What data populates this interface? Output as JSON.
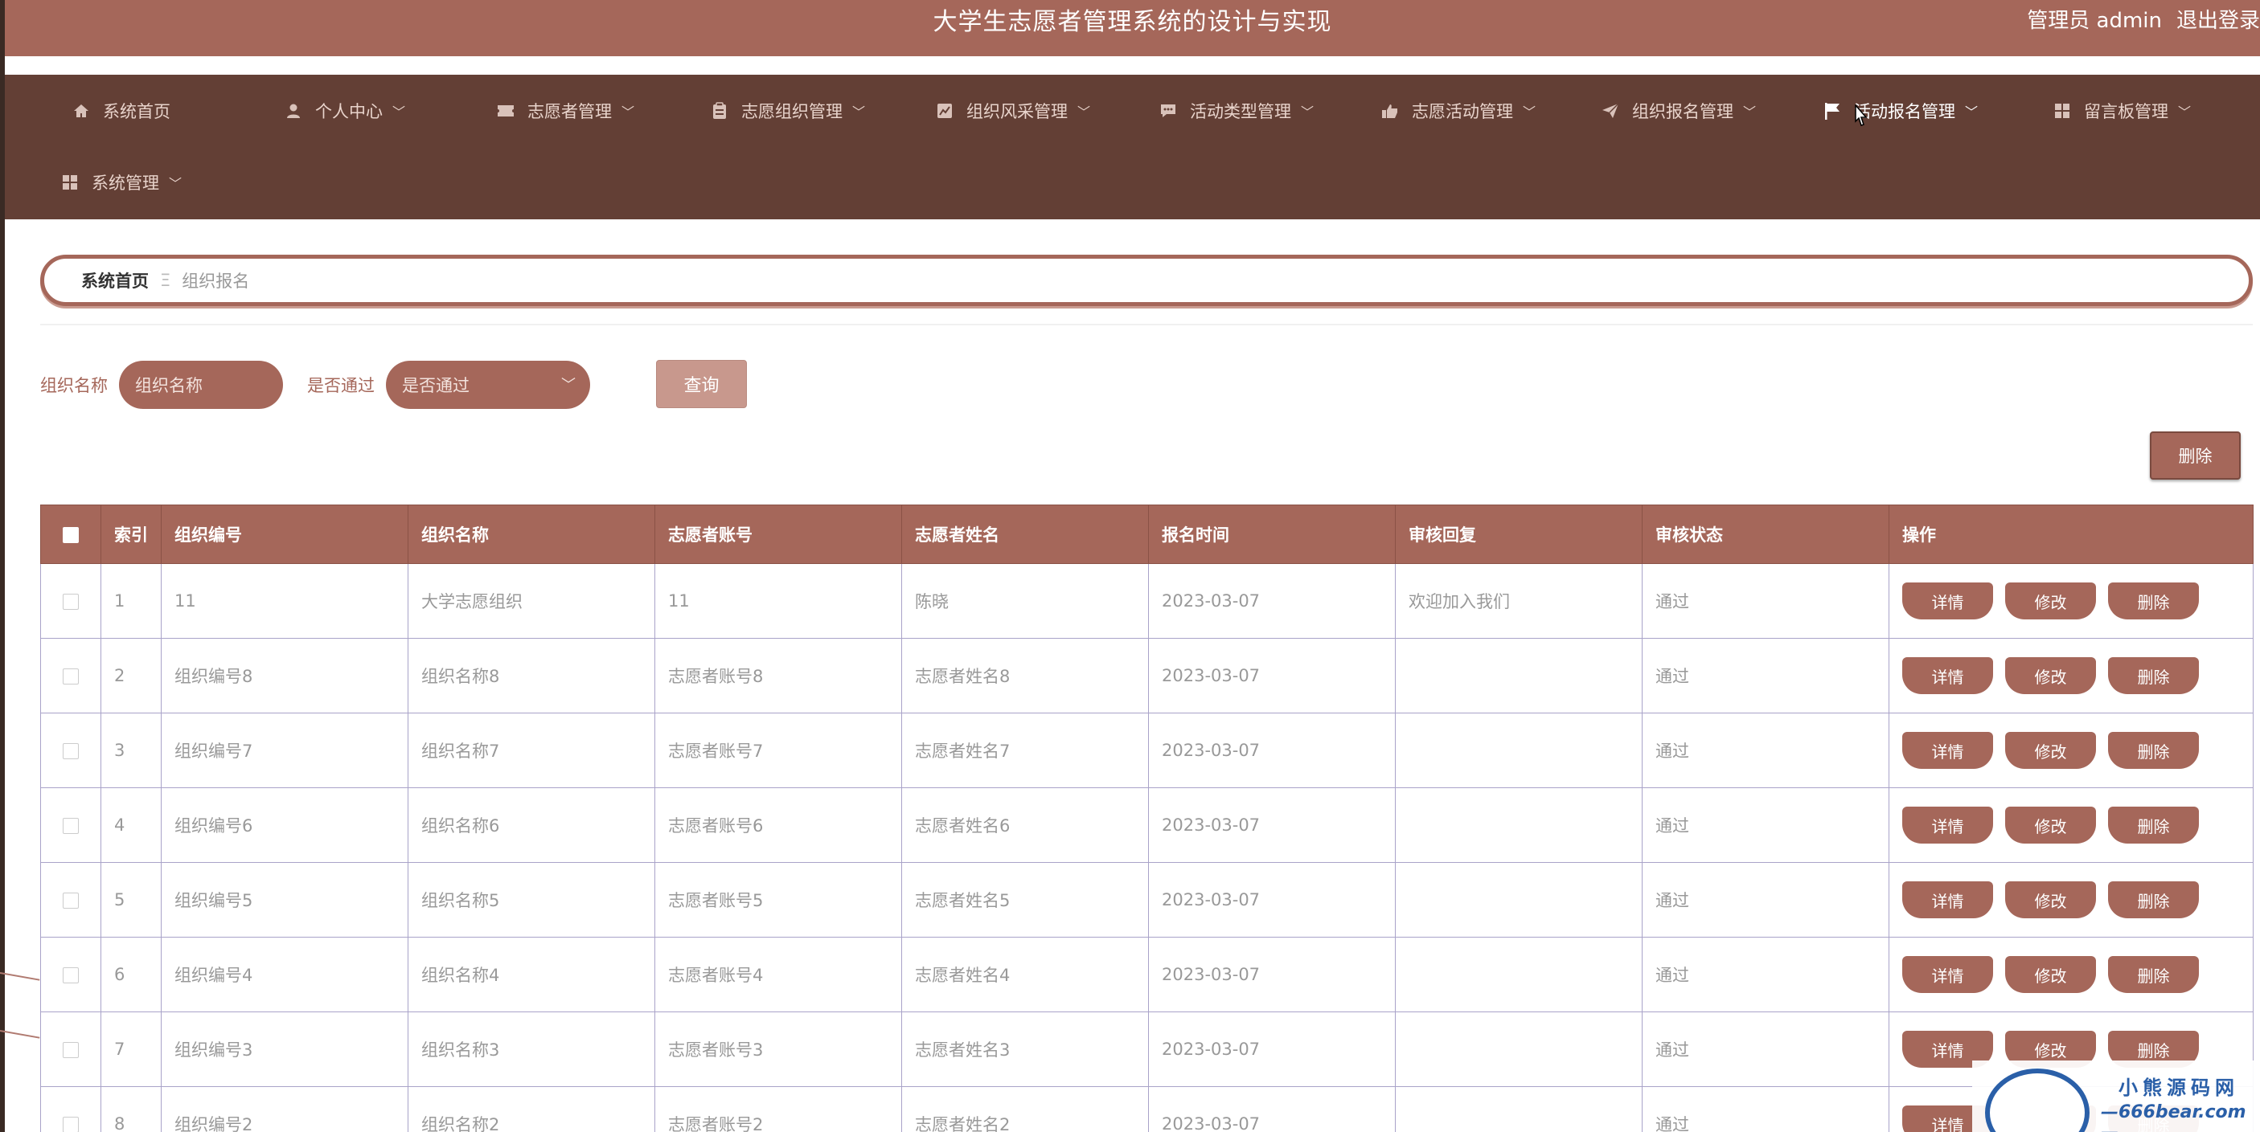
{
  "header": {
    "title": "大学生志愿者管理系统的设计与实现",
    "user": "管理员 admin",
    "logout": "退出登录"
  },
  "nav": {
    "items": [
      {
        "label": "系统首页",
        "icon": "home-icon"
      },
      {
        "label": "个人中心",
        "icon": "user-icon"
      },
      {
        "label": "志愿者管理",
        "icon": "ticket-icon"
      },
      {
        "label": "志愿组织管理",
        "icon": "clipboard-icon"
      },
      {
        "label": "组织风采管理",
        "icon": "chart-icon"
      },
      {
        "label": "活动类型管理",
        "icon": "chat-icon"
      },
      {
        "label": "志愿活动管理",
        "icon": "thumb-icon"
      },
      {
        "label": "组织报名管理",
        "icon": "send-icon"
      },
      {
        "label": "活动报名管理",
        "icon": "flag-icon"
      },
      {
        "label": "留言板管理",
        "icon": "grid-icon"
      },
      {
        "label": "系统管理",
        "icon": "grid-icon"
      }
    ]
  },
  "breadcrumb": {
    "home": "系统首页",
    "separator": "Ξ",
    "current": "组织报名"
  },
  "search": {
    "name_label": "组织名称",
    "name_placeholder": "组织名称",
    "pass_label": "是否通过",
    "pass_placeholder": "是否通过",
    "query": "查询"
  },
  "toolbar": {
    "delete": "删除"
  },
  "table": {
    "headers": [
      "索引",
      "组织编号",
      "组织名称",
      "志愿者账号",
      "志愿者姓名",
      "报名时间",
      "审核回复",
      "审核状态",
      "操作"
    ],
    "actions": {
      "detail": "详情",
      "edit": "修改",
      "delete": "删除"
    },
    "rows": [
      {
        "index": "1",
        "org_no": "11",
        "org_name": "大学志愿组织",
        "account": "11",
        "name": "陈晓",
        "time": "2023-03-07",
        "reply": "欢迎加入我们",
        "status": "通过"
      },
      {
        "index": "2",
        "org_no": "组织编号8",
        "org_name": "组织名称8",
        "account": "志愿者账号8",
        "name": "志愿者姓名8",
        "time": "2023-03-07",
        "reply": "",
        "status": "通过"
      },
      {
        "index": "3",
        "org_no": "组织编号7",
        "org_name": "组织名称7",
        "account": "志愿者账号7",
        "name": "志愿者姓名7",
        "time": "2023-03-07",
        "reply": "",
        "status": "通过"
      },
      {
        "index": "4",
        "org_no": "组织编号6",
        "org_name": "组织名称6",
        "account": "志愿者账号6",
        "name": "志愿者姓名6",
        "time": "2023-03-07",
        "reply": "",
        "status": "通过"
      },
      {
        "index": "5",
        "org_no": "组织编号5",
        "org_name": "组织名称5",
        "account": "志愿者账号5",
        "name": "志愿者姓名5",
        "time": "2023-03-07",
        "reply": "",
        "status": "通过"
      },
      {
        "index": "6",
        "org_no": "组织编号4",
        "org_name": "组织名称4",
        "account": "志愿者账号4",
        "name": "志愿者姓名4",
        "time": "2023-03-07",
        "reply": "",
        "status": "通过"
      },
      {
        "index": "7",
        "org_no": "组织编号3",
        "org_name": "组织名称3",
        "account": "志愿者账号3",
        "name": "志愿者姓名3",
        "time": "2023-03-07",
        "reply": "",
        "status": "通过"
      },
      {
        "index": "8",
        "org_no": "组织编号2",
        "org_name": "组织名称2",
        "account": "志愿者账号2",
        "name": "志愿者姓名2",
        "time": "2023-03-07",
        "reply": "",
        "status": "通过"
      }
    ]
  },
  "watermark": {
    "cn": "小熊源码网",
    "url": "—666bear.com—"
  },
  "colors": {
    "primary": "#a5675a",
    "nav": "#633f35",
    "light": "#c8988d"
  }
}
